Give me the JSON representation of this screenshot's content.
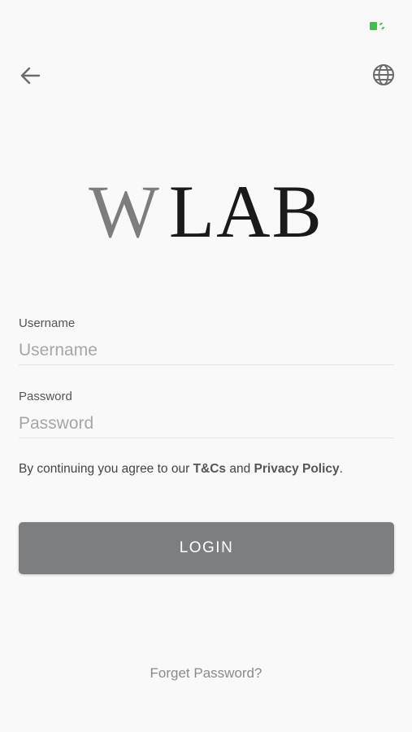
{
  "status_bar": {
    "battery_icon": "battery-charging-icon",
    "battery_color": "#3fc04f"
  },
  "nav": {
    "back_icon": "arrow-left-icon",
    "language_icon": "globe-icon"
  },
  "logo": {
    "mark": "W",
    "text": "LAB",
    "mark_color": "#7d7d7d",
    "text_color": "#1a1a1a"
  },
  "form": {
    "username": {
      "label": "Username",
      "placeholder": "Username",
      "value": ""
    },
    "password": {
      "label": "Password",
      "placeholder": "Password",
      "value": ""
    }
  },
  "agreement": {
    "prefix": "By continuing you agree to our ",
    "terms_link": "T&Cs",
    "connector": " and ",
    "privacy_link": "Privacy Policy",
    "suffix": "."
  },
  "login_button": {
    "label": "LOGIN",
    "color": "#7d7e80"
  },
  "forgot_password": {
    "label": "Forget Password?"
  }
}
